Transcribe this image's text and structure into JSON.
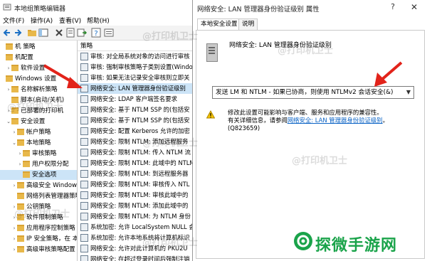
{
  "back_window": {
    "title": "本地组策略编辑器",
    "menu": [
      "文件(F)",
      "操作(A)",
      "查看(V)",
      "帮助(H)"
    ],
    "tree": [
      {
        "label": "机 策略",
        "indent": 0,
        "chev": ""
      },
      {
        "label": "机配置",
        "indent": 0,
        "chev": ""
      },
      {
        "label": "软件设置",
        "indent": 1,
        "chev": ">"
      },
      {
        "label": "Windows 设置",
        "indent": 0,
        "chev": ""
      },
      {
        "label": "名称解析策略",
        "indent": 1,
        "chev": ">"
      },
      {
        "label": "脚本(启动/关机)",
        "indent": 1,
        "chev": ""
      },
      {
        "label": "已部署的打印机",
        "indent": 1,
        "chev": ">"
      },
      {
        "label": "安全设置",
        "indent": 1,
        "chev": "v"
      },
      {
        "label": "帐户策略",
        "indent": 2,
        "chev": ">"
      },
      {
        "label": "本地策略",
        "indent": 2,
        "chev": "v"
      },
      {
        "label": "审核策略",
        "indent": 3,
        "chev": ">"
      },
      {
        "label": "用户权限分配",
        "indent": 3,
        "chev": ">"
      },
      {
        "label": "安全选项",
        "indent": 3,
        "chev": "",
        "selected": true
      },
      {
        "label": "高级安全 Window",
        "indent": 2,
        "chev": ">"
      },
      {
        "label": "网络列表管理器策略",
        "indent": 2,
        "chev": ""
      },
      {
        "label": "公钥策略",
        "indent": 2,
        "chev": ">"
      },
      {
        "label": "软件限制策略",
        "indent": 2,
        "chev": ">"
      },
      {
        "label": "应用程序控制策略",
        "indent": 2,
        "chev": ">"
      },
      {
        "label": "IP 安全策略，在 本",
        "indent": 2,
        "chev": ">"
      },
      {
        "label": "高级审核策略配置",
        "indent": 2,
        "chev": ">"
      }
    ],
    "list_header": "策略",
    "list": [
      {
        "label": "审核: 对全局系统对象的访问进行审核"
      },
      {
        "label": "审核: 强制审核策略子类别设置(Windo"
      },
      {
        "label": "审核: 如果无法记录安全审核则立即关"
      },
      {
        "label": "网络安全: LAN 管理器身份验证级别",
        "selected": true
      },
      {
        "label": "网络安全: LDAP 客户端签名要求"
      },
      {
        "label": "网络安全: 基于 NTLM SSP 的(包括安"
      },
      {
        "label": "网络安全: 基于 NTLM SSP 的(包括安"
      },
      {
        "label": "网络安全: 配置 Kerberos 允许的加密"
      },
      {
        "label": "网络安全: 限制 NTLM: 添加远程服务"
      },
      {
        "label": "网络安全: 限制 NTLM: 传入 NTLM 流"
      },
      {
        "label": "网络安全: 限制 NTLM: 此域中的 NTLM"
      },
      {
        "label": "网络安全: 限制 NTLM: 到远程服务器"
      },
      {
        "label": "网络安全: 限制 NTLM: 审核传入 NTL"
      },
      {
        "label": "网络安全: 限制 NTLM: 审核此域中的"
      },
      {
        "label": "网络安全: 限制 NTLM: 添加此域中的"
      },
      {
        "label": "网络安全: 限制 NTLM: 为 NTLM 身份"
      },
      {
        "label": "系统加密: 允许 LocalSystem NULL 会"
      },
      {
        "label": "系统加密: 允许本地系统将计算机标识"
      },
      {
        "label": "网络安全: 允许对此计算机的 PKU2U"
      },
      {
        "label": "网络安全: 在超过登录时间后强制注销"
      }
    ]
  },
  "dialog": {
    "title": "网络安全: LAN 管理器身份验证级别 属性",
    "help": "?",
    "close": "✕",
    "tabs": [
      "本地安全设置",
      "说明"
    ],
    "policy_title": "网络安全: LAN 管理器身份验证级别",
    "combo_value": "发送 LM 和 NTLM - 如果已协商，则使用 NTLMv2 会话安全(&)",
    "warning_line1": "修改此设置可能影响与客户端、服务和应用程序的兼容性。",
    "warning_line2_prefix": "有关详细信息，请参阅",
    "warning_link": "网络安全: LAN 管理器身份验证级别",
    "warning_line2_suffix": "。",
    "warning_line3": "(Q823659)"
  },
  "watermark": {
    "brand": "探微手游网",
    "track": "@打印机卫士"
  },
  "colors": {
    "arrow": "#e2231a",
    "brand": "#1aa34a",
    "link": "#0b63c5",
    "selection": "#cce4f7"
  }
}
